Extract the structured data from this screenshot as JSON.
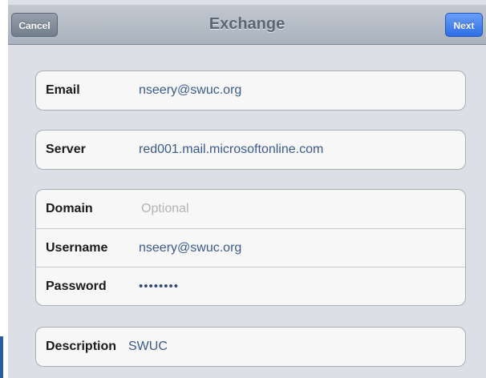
{
  "navbar": {
    "title": "Exchange",
    "cancel_label": "Cancel",
    "next_label": "Next"
  },
  "account": {
    "email": {
      "label": "Email",
      "value": "nseery@swuc.org"
    },
    "server": {
      "label": "Server",
      "value": "red001.mail.microsoftonline.com"
    },
    "domain": {
      "label": "Domain",
      "placeholder": "Optional"
    },
    "username": {
      "label": "Username",
      "value": "nseery@swuc.org"
    },
    "password": {
      "label": "Password",
      "value": "••••••••"
    },
    "description": {
      "label": "Description",
      "value": "SWUC"
    }
  },
  "colors": {
    "background": "#dcdfe5",
    "navbar": "#b4bcc6",
    "next_button": "#3a7bf0",
    "value_text": "#3a5a8c"
  }
}
